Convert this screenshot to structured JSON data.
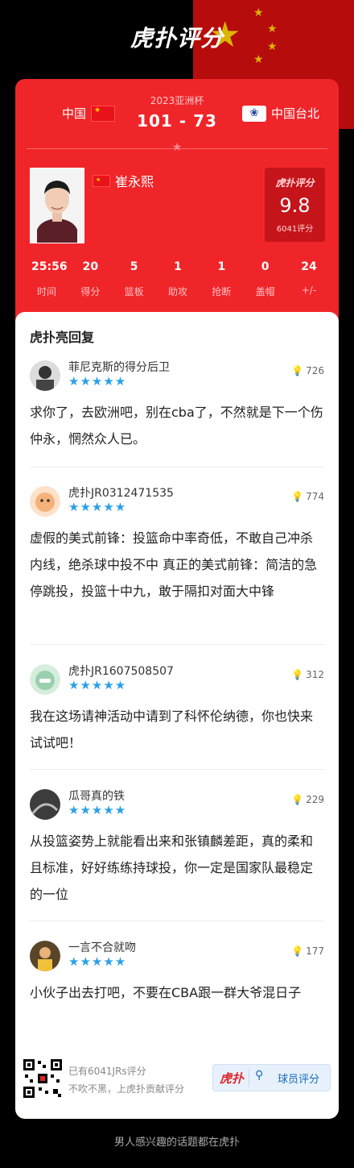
{
  "brand": {
    "logo": "虎扑评分"
  },
  "match": {
    "event": "2023亚洲杯",
    "score": "101 - 73",
    "home_team": "中国",
    "away_team": "中国台北"
  },
  "player": {
    "name": "崔永熙",
    "rating_label": "虎扑评分",
    "rating": "9.8",
    "rating_count": "6041评分"
  },
  "stats": [
    {
      "value": "25:56",
      "label": "时间"
    },
    {
      "value": "20",
      "label": "得分"
    },
    {
      "value": "5",
      "label": "篮板"
    },
    {
      "value": "1",
      "label": "助攻"
    },
    {
      "value": "1",
      "label": "抢断"
    },
    {
      "value": "0",
      "label": "盖帽"
    },
    {
      "value": "24",
      "label": "+/-"
    }
  ],
  "comments_section": {
    "title": "虎扑亮回复"
  },
  "comments": [
    {
      "user": "菲尼克斯的得分后卫",
      "stars": "★★★★★",
      "likes": "726",
      "text": "求你了，去欧洲吧，别在cba了，不然就是下一个伤仲永，惘然众人已。"
    },
    {
      "user": "虎扑JR0312471535",
      "stars": "★★★★★",
      "likes": "774",
      "text": "虚假的美式前锋：投篮命中率奇低，不敢自己冲杀内线，绝杀球中投不中 真正的美式前锋：简洁的急停跳投，投篮十中九，敢于隔扣对面大中锋"
    },
    {
      "user": "虎扑JR1607508507",
      "stars": "★★★★★",
      "likes": "312",
      "text": "我在这场请神活动中请到了科怀伦纳德，你也快来试试吧！"
    },
    {
      "user": "瓜哥真的铁",
      "stars": "★★★★★",
      "likes": "229",
      "text": "从投篮姿势上就能看出来和张镇麟差距，真的柔和且标准，好好练练持球投，你一定是国家队最稳定的一位"
    },
    {
      "user": "一言不合就吻",
      "stars": "★★★★★",
      "likes": "177",
      "text": "小伙子出去打吧，不要在CBA跟一群大爷混日子"
    }
  ],
  "footer": {
    "line1": "已有6041JRs评分",
    "line2": "不吹不黑，上虎扑贡献评分",
    "search_logo": "虎扑",
    "search_label": "球员评分"
  },
  "bottom_text": "男人感兴趣的话题都在虎扑",
  "colors": {
    "accent_red": "#f0252a",
    "star_blue": "#2aa0e8"
  }
}
